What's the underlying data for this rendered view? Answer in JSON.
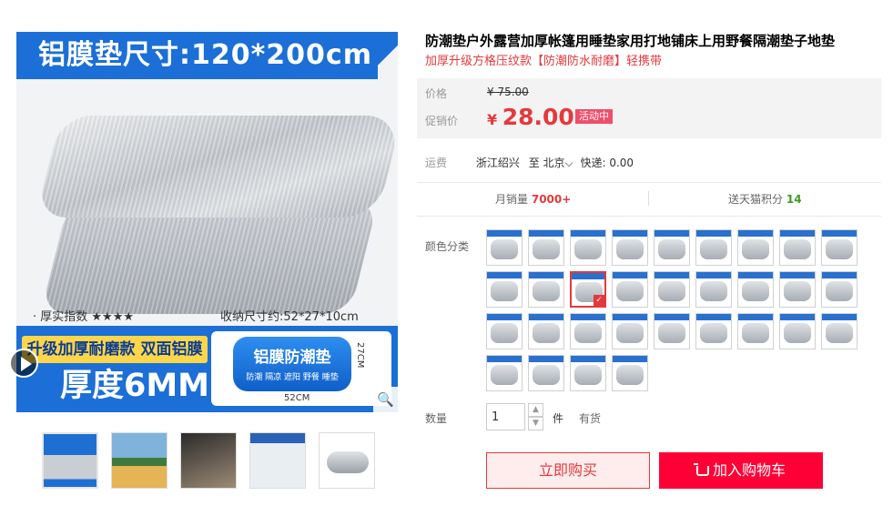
{
  "product": {
    "title": "防潮垫户外露营加厚帐篷用睡垫家用打地铺床上用野餐隔潮垫子地垫",
    "subtitle": "加厚升级方格压纹款【防潮防水耐磨】轻携带"
  },
  "main_image": {
    "banner": "铝膜垫尺寸:120*200cm",
    "thickness_index": "· 厚实指数 ★★★★",
    "folded_size": "收纳尺寸约:52*27*10cm",
    "upgrade_tag": "升级加厚耐磨款 双面铝膜",
    "thickness": "厚度6MM",
    "bag_title": "铝膜防潮垫",
    "bag_features": "防潮 隔凉 遮阳 野餐 睡垫",
    "dim_height": "27CM",
    "dim_width": "52CM",
    "icons": {
      "play": "play-icon",
      "zoom": "zoom-icon"
    }
  },
  "price": {
    "label_original": "价格",
    "original": "¥ 75.00",
    "label_promo": "促销价",
    "currency": "¥",
    "promo": "28.00",
    "event_badge": "活动中"
  },
  "shipping": {
    "label": "运费",
    "from": "浙江绍兴",
    "to_prefix": "至",
    "destination": "北京",
    "method": "快递: 0.00"
  },
  "stats": {
    "monthly_sales_label": "月销量",
    "monthly_sales": "7000+",
    "points_label": "送天猫积分",
    "points": "14"
  },
  "sku": {
    "label": "颜色分类",
    "count": 31,
    "selected_index": 11
  },
  "quantity": {
    "label": "数量",
    "value": "1",
    "up": "▲",
    "down": "▼",
    "unit": "件",
    "stock": "有货"
  },
  "actions": {
    "buy_now": "立即购买",
    "add_to_cart": "加入购物车"
  },
  "colors": {
    "accent": "#e4393c",
    "cart": "#ff0036",
    "brand_blue": "#1b6fd6"
  }
}
